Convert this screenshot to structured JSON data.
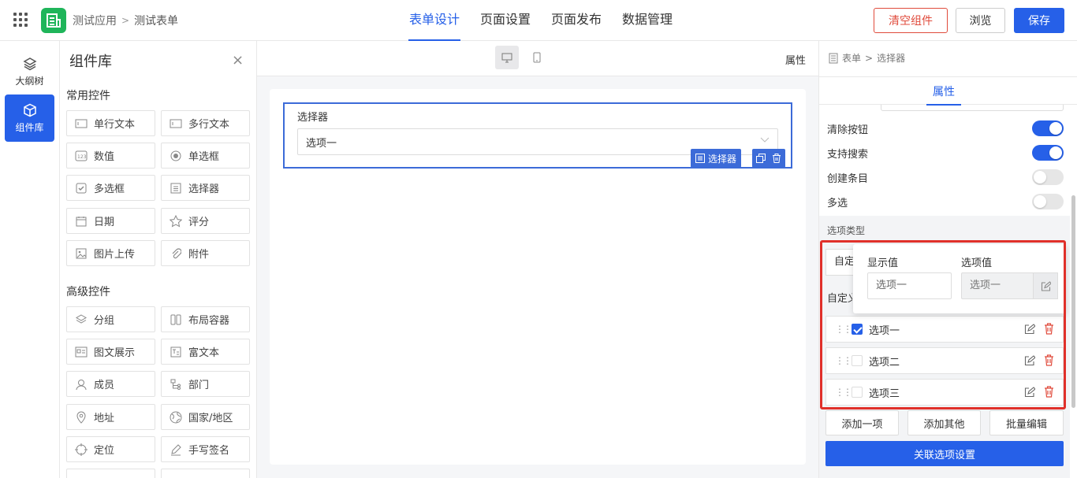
{
  "header": {
    "app_name": "测试应用",
    "breadcrumb_sep": ">",
    "form_name": "测试表单",
    "tabs": [
      "表单设计",
      "页面设置",
      "页面发布",
      "数据管理"
    ],
    "active_tab": "表单设计",
    "clear_label": "清空组件",
    "preview_label": "浏览",
    "save_label": "保存"
  },
  "leftnav": {
    "outline_label": "大纲树",
    "components_label": "组件库"
  },
  "library": {
    "title": "组件库",
    "close": "×",
    "common_title": "常用控件",
    "common": [
      "单行文本",
      "多行文本",
      "数值",
      "单选框",
      "多选框",
      "选择器",
      "日期",
      "评分",
      "图片上传",
      "附件"
    ],
    "advanced_title": "高级控件",
    "advanced": [
      "分组",
      "布局容器",
      "图文展示",
      "富文本",
      "成员",
      "部门",
      "地址",
      "国家/地区",
      "定位",
      "手写签名"
    ]
  },
  "canvas": {
    "attr_label": "属性",
    "field_label": "选择器",
    "field_value": "选项一",
    "tag_label": "选择器"
  },
  "props": {
    "crumb_form": "表单",
    "crumb_sep": ">",
    "crumb_item": "选择器",
    "tab_label": "属性",
    "toggles": [
      {
        "label": "清除按钮",
        "on": true
      },
      {
        "label": "支持搜索",
        "on": true
      },
      {
        "label": "创建条目",
        "on": false
      },
      {
        "label": "多选",
        "on": false
      }
    ],
    "option_type_label": "选项类型",
    "option_type_value": "自定义",
    "custom_label": "自定义选项",
    "options": [
      {
        "label": "选项一",
        "checked": true
      },
      {
        "label": "选项二",
        "checked": false
      },
      {
        "label": "选项三",
        "checked": false
      }
    ],
    "popover": {
      "display_header": "显示值",
      "value_header": "选项值",
      "display_value": "选项一",
      "option_value": "选项一"
    },
    "add_one_label": "添加一项",
    "add_other_label": "添加其他",
    "batch_edit_label": "批量编辑",
    "link_label": "关联选项设置"
  },
  "colors": {
    "primary": "#2660e8",
    "danger": "#e04b3c",
    "app_green": "#1fb55a",
    "highlight": "#e0302a"
  }
}
